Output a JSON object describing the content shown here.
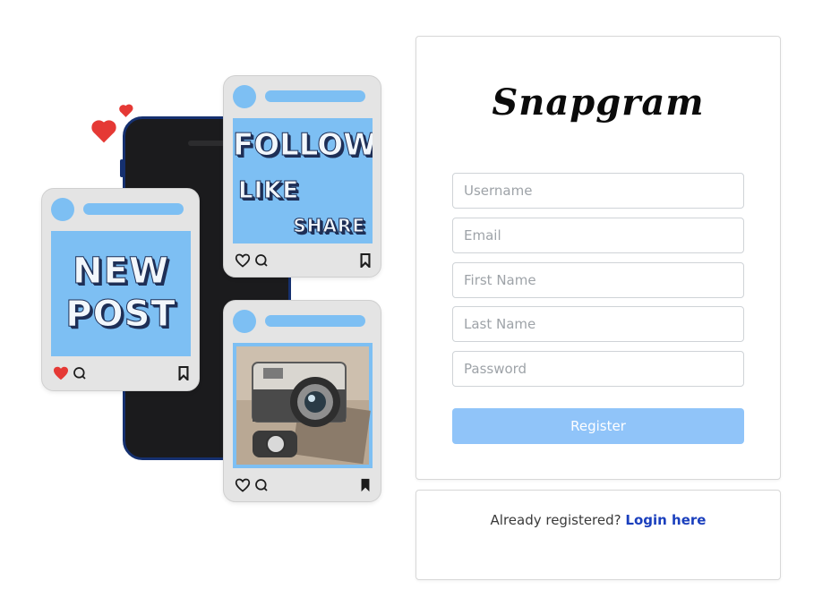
{
  "app": {
    "title": "Snapgram"
  },
  "illustration": {
    "post1": {
      "line1": "NEW",
      "line2": "POST"
    },
    "post2": {
      "line1": "FOLLOW",
      "line2": "LIKE",
      "line3": "SHARE"
    },
    "colors": {
      "accent": "#7dbff3",
      "heart": "#e53935"
    }
  },
  "form": {
    "username": {
      "placeholder": "Username",
      "value": ""
    },
    "email": {
      "placeholder": "Email",
      "value": ""
    },
    "first_name": {
      "placeholder": "First Name",
      "value": ""
    },
    "last_name": {
      "placeholder": "Last Name",
      "value": ""
    },
    "password": {
      "placeholder": "Password",
      "value": ""
    },
    "register_label": "Register",
    "button_color": "#90c4f9"
  },
  "footer": {
    "prompt": "Already registered?",
    "login_label": "Login here",
    "link_color": "#1a3fbd"
  }
}
